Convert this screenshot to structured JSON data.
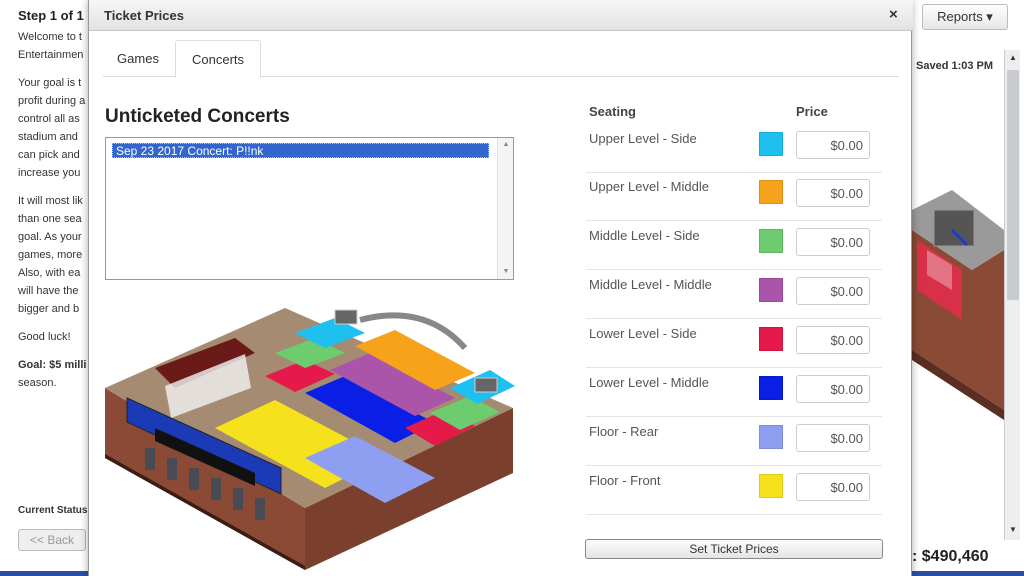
{
  "background": {
    "step_title": "Step 1 of 1",
    "paragraphs": [
      "Welcome to t",
      "Entertainmen",
      "Your goal is t",
      "profit during a",
      "control all as",
      "stadium and",
      "can pick and",
      "increase you",
      "It will most lik",
      "than one sea",
      "goal. As your",
      "games, more",
      "Also, with ea",
      "will have the",
      "bigger and b",
      "Good luck!",
      "Goal: $5 milli",
      "season."
    ],
    "current_status_label": "Current Status:",
    "back_label": "<< Back",
    "reports_label": "Reports ▾",
    "saved_label": "Saved 1:03 PM",
    "money": ": $490,460"
  },
  "modal": {
    "title": "Ticket Prices",
    "close": "×",
    "tabs": [
      "Games",
      "Concerts"
    ],
    "active_tab": "Concerts",
    "section_title": "Unticketed Concerts",
    "concerts": [
      "Sep 23 2017 Concert: P!!nk"
    ],
    "selected_concert": "Sep 23 2017 Concert: P!!nk",
    "table_headers": {
      "seating": "Seating",
      "price": "Price"
    },
    "sections": [
      {
        "label": "Upper Level - Side",
        "color": "#1ec0f0",
        "price": "$0.00"
      },
      {
        "label": "Upper Level - Middle",
        "color": "#f7a21b",
        "price": "$0.00"
      },
      {
        "label": "Middle Level - Side",
        "color": "#6dcc6d",
        "price": "$0.00"
      },
      {
        "label": "Middle Level - Middle",
        "color": "#aa55aa",
        "price": "$0.00"
      },
      {
        "label": "Lower Level - Side",
        "color": "#e6194b",
        "price": "$0.00"
      },
      {
        "label": "Lower Level - Middle",
        "color": "#0a1fe6",
        "price": "$0.00"
      },
      {
        "label": "Floor - Rear",
        "color": "#8e9ef0",
        "price": "$0.00"
      },
      {
        "label": "Floor - Front",
        "color": "#f6e21c",
        "price": "$0.00"
      }
    ],
    "submit_label": "Set Ticket Prices"
  }
}
